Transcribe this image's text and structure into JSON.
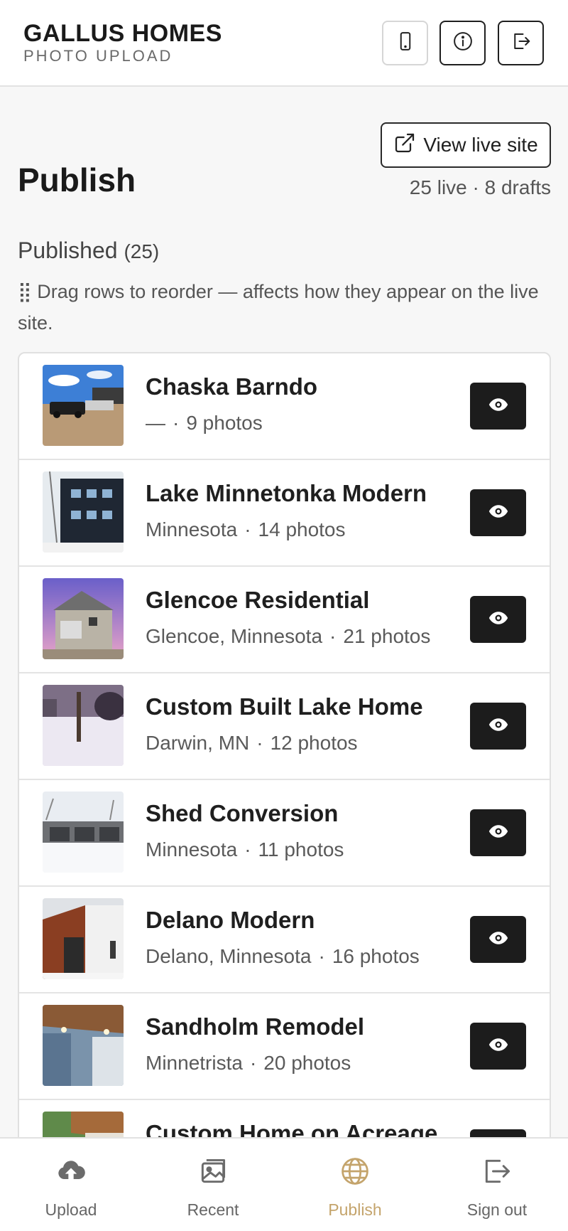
{
  "header": {
    "brand": "GALLUS HOMES",
    "subtitle": "PHOTO UPLOAD",
    "icons": [
      "phone-icon",
      "info-icon",
      "logout-icon"
    ]
  },
  "page": {
    "title": "Publish",
    "view_live_label": "View live site",
    "counts": "25 live · 8 drafts",
    "section_title": "Published",
    "section_count": "(25)",
    "hint": "⣿ Drag rows to reorder — affects how they appear on the live site."
  },
  "projects": [
    {
      "title": "Chaska Barndo",
      "location": "—",
      "photos": "9 photos"
    },
    {
      "title": "Lake Minnetonka Modern",
      "location": "Minnesota",
      "photos": "14 photos"
    },
    {
      "title": "Glencoe Residential",
      "location": "Glencoe, Minnesota",
      "photos": "21 photos"
    },
    {
      "title": "Custom Built Lake Home",
      "location": "Darwin, MN",
      "photos": "12 photos"
    },
    {
      "title": "Shed Conversion",
      "location": "Minnesota",
      "photos": "11 photos"
    },
    {
      "title": "Delano Modern",
      "location": "Delano, Minnesota",
      "photos": "16 photos"
    },
    {
      "title": "Sandholm Remodel",
      "location": "Minnetrista",
      "photos": "20 photos"
    },
    {
      "title": "Custom Home on Acreage",
      "location": "",
      "photos": ""
    }
  ],
  "nav": {
    "items": [
      {
        "label": "Upload"
      },
      {
        "label": "Recent"
      },
      {
        "label": "Publish"
      },
      {
        "label": "Sign out"
      }
    ],
    "active": "Publish"
  },
  "colors": {
    "accent": "#c4a46c",
    "dark_button": "#1c1c1c",
    "background": "#f7f7f7"
  }
}
